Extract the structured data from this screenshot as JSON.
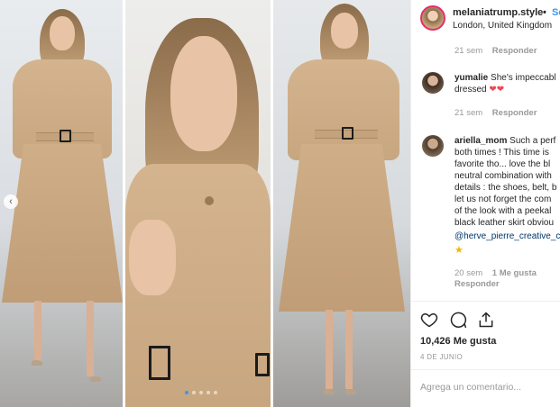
{
  "post": {
    "username": "melaniatrump.style",
    "separator": "•",
    "follow_label": "Seguir",
    "location": "London, United Kingdom"
  },
  "comments": [
    {
      "username": "",
      "text": "",
      "time": "21 sem",
      "reply_label": "Responder"
    },
    {
      "username": "yumalie",
      "lines": [
        "She's impeccabl",
        "dressed"
      ],
      "hearts": "❤❤",
      "time": "21 sem",
      "reply_label": "Responder"
    },
    {
      "username": "ariella_mom",
      "lines": [
        "Such a perf",
        "both times ! This time is",
        "favorite tho... love the bl",
        "neutral combination with",
        "details : the shoes, belt, b",
        "let us not forget the com",
        "of the look with a peekal",
        "black leather skirt obviou",
        "@herve_pierre_creative_c"
      ],
      "star": "★",
      "time": "20 sem",
      "likes_label": "1 Me gusta",
      "reply_label": "Responder"
    }
  ],
  "actions": {
    "like_icon": "heart-icon",
    "comment_icon": "comment-icon",
    "share_icon": "share-icon"
  },
  "likes_text": "10,426 Me gusta",
  "date_text": "4 DE JUNIO",
  "add_comment_placeholder": "Agrega un comentario...",
  "carousel": {
    "slide_count": 5,
    "active_index": 0
  }
}
